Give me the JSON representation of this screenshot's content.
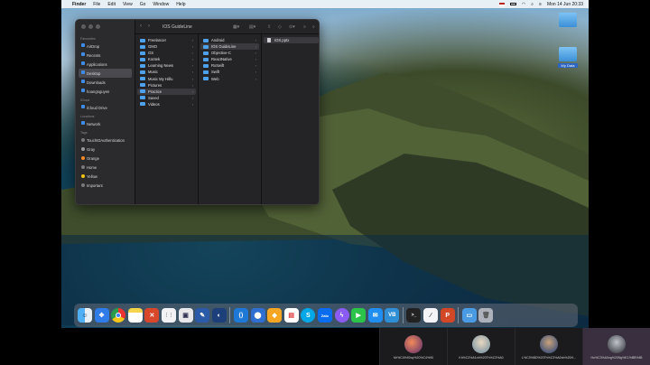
{
  "menubar": {
    "app": "Finder",
    "items": [
      "File",
      "Edit",
      "View",
      "Go",
      "Window",
      "Help"
    ],
    "clock": "Mon 14 Jun  20:33"
  },
  "desktop": {
    "folder_label": "My Data"
  },
  "finder": {
    "title": "IOS GuideLine",
    "sidebar": {
      "favourites_header": "Favourites",
      "favourites": [
        "AirDrop",
        "Recents",
        "Applications",
        "Desktop",
        "Downloads",
        "hoangnguyen"
      ],
      "icloud_header": "iCloud",
      "icloud": [
        "iCloud Drive"
      ],
      "locations_header": "Locations",
      "locations": [
        "Network"
      ],
      "tags_header": "Tags",
      "tags": [
        {
          "label": "TouchIDAuthentication",
          "color": "#7a7a7e"
        },
        {
          "label": "Gray",
          "color": "#9a9a9e"
        },
        {
          "label": "Orange",
          "color": "#f08a24"
        },
        {
          "label": "Home",
          "color": "#7a7a7e"
        },
        {
          "label": "Yellow",
          "color": "#f2c40f"
        },
        {
          "label": "Important",
          "color": "#7a7a7e"
        }
      ]
    },
    "col1": [
      "Freelancer",
      "GMO",
      "GS",
      "Kontek",
      "Learning News",
      "Music",
      "Music My Hiếu",
      "Pictures",
      "Practice",
      "Saved",
      "Videos"
    ],
    "col2": [
      "Android",
      "IOS GuideLine",
      "Objective-C",
      "ReactNative",
      "RxSwift",
      "Swift",
      "Web"
    ],
    "col3": [
      "IOS.pptx"
    ]
  },
  "dock_icons": [
    "finder-icon",
    "safari-icon",
    "chrome-icon",
    "notes-icon",
    "tool-icon",
    "reminders-icon",
    "preview-icon",
    "editor-icon",
    "terminal-blue-icon",
    "vscode-icon",
    "maps-icon",
    "sketch-icon",
    "table-icon",
    "skype-icon",
    "zalo-icon",
    "messenger-icon",
    "facetime-icon",
    "mail-icon",
    "vb-icon",
    "terminal-icon",
    "pen-icon",
    "powerpoint-icon",
    "folder-dock-icon",
    "trash-icon"
  ],
  "taskbar": [
    {
      "label": "Mr%C4%90oy%20%C4%90"
    },
    {
      "label": "Kh%C3%A1nh%20Th%C3%A0"
    },
    {
      "label": "L%C3%BD%20Th%C3%A0nh%20H..."
    },
    {
      "label": "Ho%C3%A0ng%20Ng%E1%BB%85"
    }
  ],
  "colors": {
    "accent": "#3d8ee8",
    "window_bg": "#242426",
    "sidebar_bg": "#2b2b2e"
  }
}
